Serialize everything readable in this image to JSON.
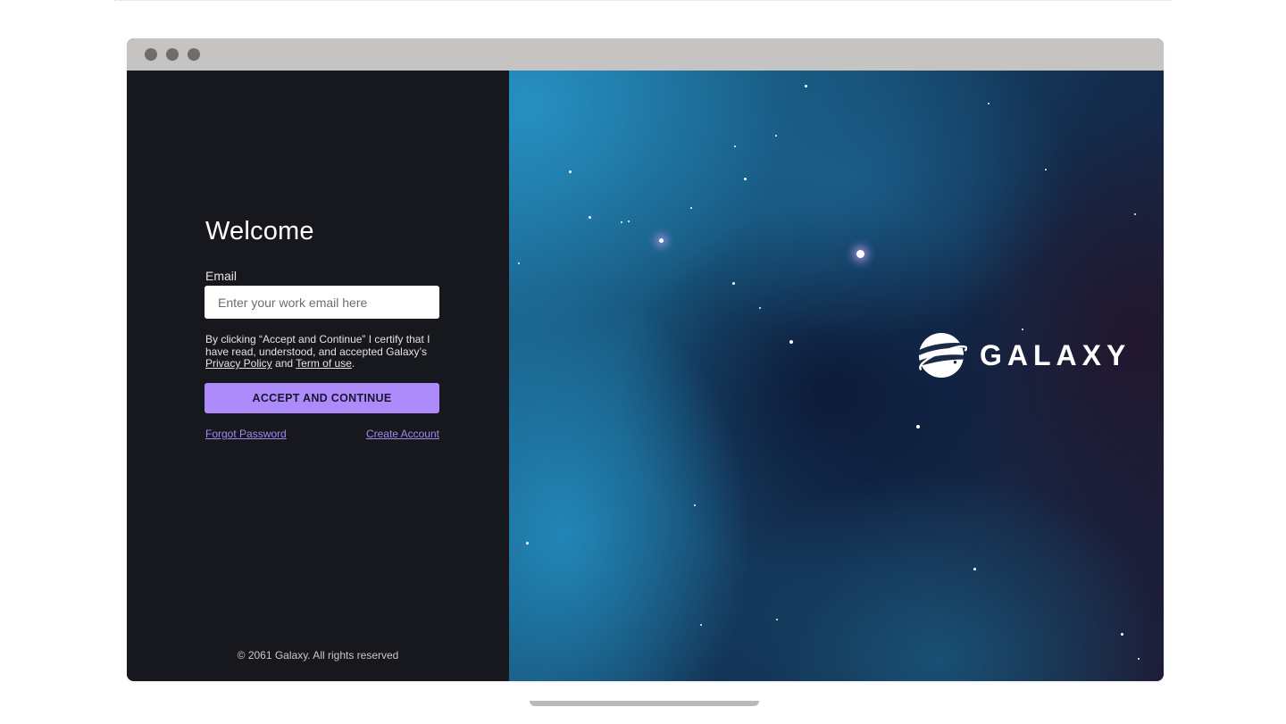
{
  "window": {
    "traffic_lights": [
      "close",
      "minimize",
      "maximize"
    ]
  },
  "login": {
    "title": "Welcome",
    "email_label": "Email",
    "email_placeholder": "Enter your work email here",
    "email_value": "",
    "consent_prefix": "By clicking “Accept and Continue” I certify that I have read, understood, and accepted Galaxy’s ",
    "privacy_link": "Privacy Policy",
    "consent_and": " and ",
    "terms_link": "Term of use",
    "consent_suffix": ".",
    "accept_button": "ACCEPT AND CONTINUE",
    "forgot_password": "Forgot Password",
    "create_account": "Create Account",
    "footer": "© 2061 Galaxy. All rights reserved"
  },
  "brand": {
    "name": "GALAXY",
    "logo_icon": "planet-ring-icon"
  },
  "colors": {
    "panel_background": "#17181d",
    "accent": "#ad8bfa",
    "link": "#a487f0",
    "titlebar": "#c6c4c2"
  }
}
